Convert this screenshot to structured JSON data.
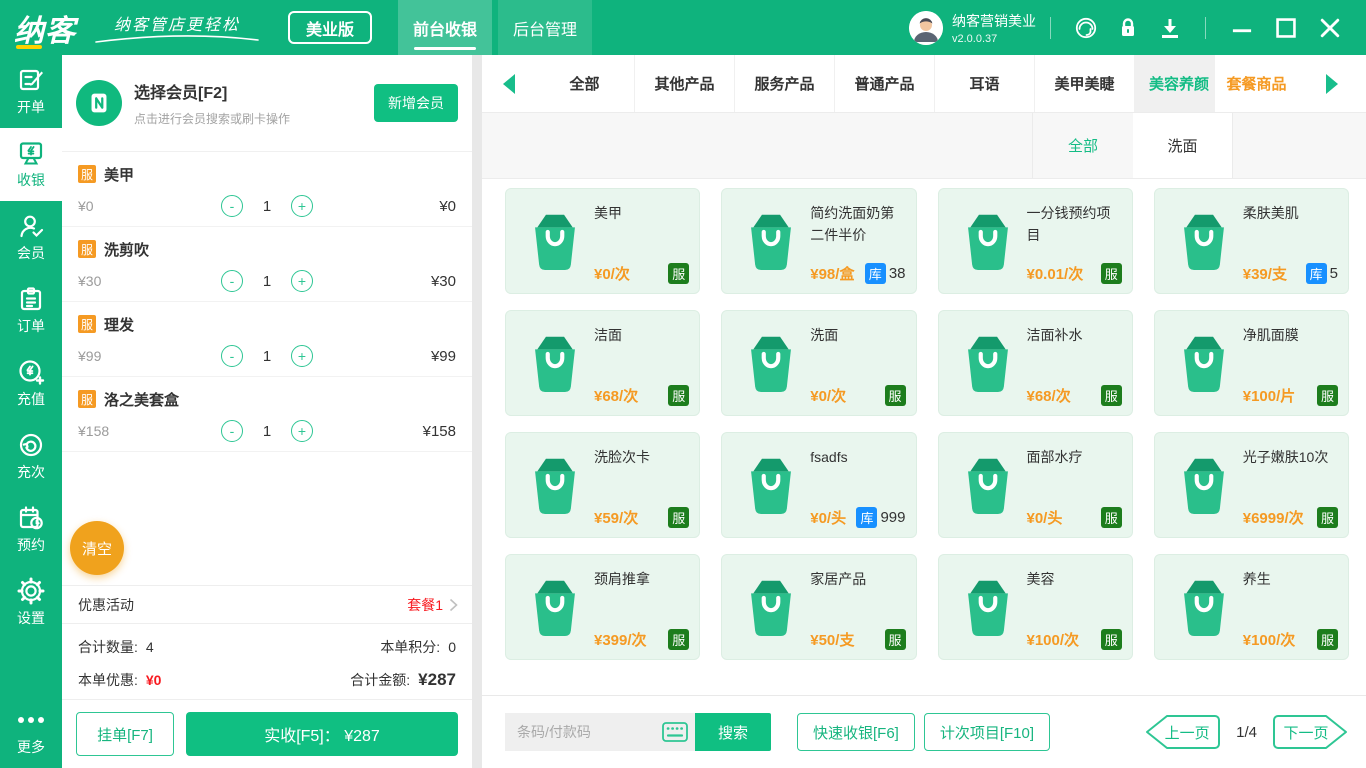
{
  "header": {
    "logo": "纳客",
    "slogan": "纳客管店更轻松",
    "edition": "美业版",
    "nav_tabs": [
      {
        "label": "前台收银"
      },
      {
        "label": "后台管理"
      }
    ],
    "user": {
      "name": "纳客营销美业",
      "version": "v2.0.0.37"
    },
    "icons": [
      "avatar",
      "support-icon",
      "lock-icon",
      "download-icon",
      "minimize-icon",
      "maximize-icon",
      "close-icon"
    ]
  },
  "sidebar": {
    "items": [
      {
        "label": "开单",
        "icon": "billing-icon"
      },
      {
        "label": "收银",
        "icon": "cashier-icon",
        "active": true
      },
      {
        "label": "会员",
        "icon": "members-icon"
      },
      {
        "label": "订单",
        "icon": "orders-icon"
      },
      {
        "label": "充值",
        "icon": "recharge-icon"
      },
      {
        "label": "充次",
        "icon": "recharge-times-icon"
      },
      {
        "label": "预约",
        "icon": "appointment-icon"
      },
      {
        "label": "设置",
        "icon": "settings-icon"
      },
      {
        "label": "更多",
        "icon": "more-dots-icon"
      }
    ]
  },
  "member": {
    "title": "选择会员[F2]",
    "subtitle": "点击进行会员搜索或刷卡操作",
    "add_button": "新增会员"
  },
  "cart": {
    "items": [
      {
        "tag": "服",
        "name": "美甲",
        "price": "¥0",
        "minus": "-",
        "qty": "1",
        "plus": "+",
        "total": "¥0"
      },
      {
        "tag": "服",
        "name": "洗剪吹",
        "price": "¥30",
        "minus": "-",
        "qty": "1",
        "plus": "+",
        "total": "¥30"
      },
      {
        "tag": "服",
        "name": "理发",
        "price": "¥99",
        "minus": "-",
        "qty": "1",
        "plus": "+",
        "total": "¥99"
      },
      {
        "tag": "服",
        "name": "洛之美套盒",
        "price": "¥158",
        "minus": "-",
        "qty": "1",
        "plus": "+",
        "total": "¥158"
      }
    ],
    "clear_button": "清空",
    "promo_label": "优惠活动",
    "promo_value": "套餐1",
    "summary": {
      "qty_label": "合计数量:",
      "qty_value": "4",
      "points_label": "本单积分:",
      "points_value": "0",
      "discount_label": "本单优惠:",
      "discount_value": "¥0",
      "amount_label": "合计金额:",
      "amount_value": "¥287"
    },
    "hold_button": "挂单[F7]",
    "pay_button": "实收[F5]： ¥287"
  },
  "categories": {
    "tabs": [
      {
        "label": "全部"
      },
      {
        "label": "其他产品"
      },
      {
        "label": "服务产品"
      },
      {
        "label": "普通产品"
      },
      {
        "label": "耳语"
      },
      {
        "label": "美甲美睫"
      },
      {
        "label": "美容养颜",
        "active": true
      },
      {
        "label": "套餐商品"
      }
    ],
    "subtabs": [
      {
        "label": "全部",
        "active": true
      },
      {
        "label": "洗面"
      }
    ]
  },
  "products": [
    {
      "name": "美甲",
      "price": "¥0/次",
      "badge": "服"
    },
    {
      "name": "简约洗面奶第二件半价",
      "price": "¥98/盒",
      "badge": "库",
      "stock": "38"
    },
    {
      "name": "一分钱预约项目",
      "price": "¥0.01/次",
      "badge": "服"
    },
    {
      "name": "柔肤美肌",
      "price": "¥39/支",
      "badge": "库",
      "stock": "5"
    },
    {
      "name": "洁面",
      "price": "¥68/次",
      "badge": "服"
    },
    {
      "name": "洗面",
      "price": "¥0/次",
      "badge": "服"
    },
    {
      "name": "洁面补水",
      "price": "¥68/次",
      "badge": "服"
    },
    {
      "name": "净肌面膜",
      "price": "¥100/片",
      "badge": "服"
    },
    {
      "name": "洗脸次卡",
      "price": "¥59/次",
      "badge": "服"
    },
    {
      "name": "fsadfs",
      "price": "¥0/头",
      "badge": "库",
      "stock": "999"
    },
    {
      "name": "面部水疗",
      "price": "¥0/头",
      "badge": "服"
    },
    {
      "name": "光子嫩肤10次",
      "price": "¥6999/次",
      "badge": "服"
    },
    {
      "name": "颈肩推拿",
      "price": "¥399/次",
      "badge": "服"
    },
    {
      "name": "家居产品",
      "price": "¥50/支",
      "badge": "服"
    },
    {
      "name": "美容",
      "price": "¥100/次",
      "badge": "服"
    },
    {
      "name": "养生",
      "price": "¥100/次",
      "badge": "服"
    }
  ],
  "bottom_bar": {
    "search_placeholder": "条码/付款码",
    "search_button": "搜索",
    "quick_cashier": "快速收银[F6]",
    "count_project": "计次项目[F10]",
    "prev": "上一页",
    "page": "1/4",
    "next": "下一页"
  },
  "colors": {
    "primary_green": "#0fb37d",
    "accent_green": "#2ec694",
    "price_orange": "#f59a23",
    "service_badge_green": "#1d7d1d",
    "stock_badge_blue": "#1890ff",
    "clear_orange": "#f0a21d",
    "alert_red": "#f8191f"
  }
}
